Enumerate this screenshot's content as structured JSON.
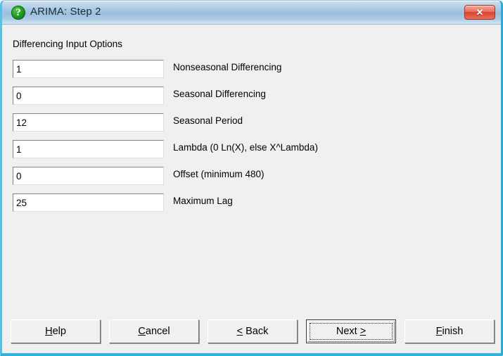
{
  "window": {
    "title": "ARIMA: Step 2",
    "icon": "question-mark-green-icon",
    "close_label": "✕",
    "frame_color": "#32b0de",
    "titlebar_color": "#9dbfdd",
    "close_color": "#d8432f"
  },
  "content": {
    "group_heading": "Differencing Input Options",
    "fields": [
      {
        "value": "1",
        "label": "Nonseasonal Differencing"
      },
      {
        "value": "0",
        "label": "Seasonal Differencing"
      },
      {
        "value": "12",
        "label": "Seasonal Period"
      },
      {
        "value": "1",
        "label": "Lambda (0 Ln(X), else X^Lambda)"
      },
      {
        "value": "0",
        "label": "Offset (minimum 480)"
      },
      {
        "value": "25",
        "label": "Maximum Lag"
      }
    ]
  },
  "buttons": {
    "help": {
      "prefix": "",
      "accel": "H",
      "suffix": "elp"
    },
    "cancel": {
      "prefix": "",
      "accel": "C",
      "suffix": "ancel"
    },
    "back": {
      "prefix": "",
      "accel": "<",
      "suffix": " Back"
    },
    "next": {
      "prefix": "Next ",
      "accel": ">",
      "suffix": ""
    },
    "finish": {
      "prefix": "",
      "accel": "F",
      "suffix": "inish"
    }
  }
}
